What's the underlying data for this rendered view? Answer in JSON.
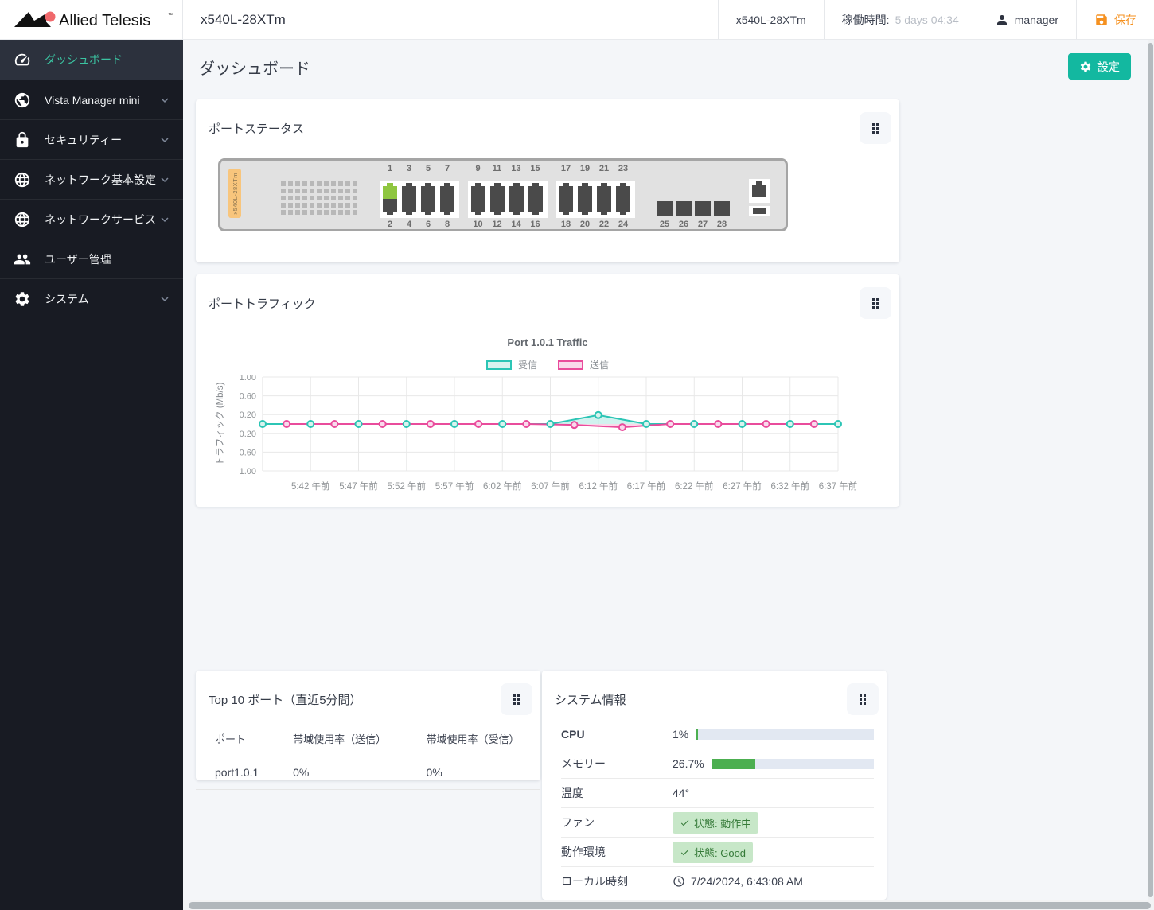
{
  "header": {
    "brand": "Allied Telesis",
    "device_title": "x540L-28XTm",
    "device_name": "x540L-28XTm",
    "uptime_label": "稼働時間:",
    "uptime_value": "5 days 04:34",
    "user": "manager",
    "save_label": "保存",
    "save_color": "#f59120"
  },
  "sidebar": {
    "items": [
      {
        "label": "ダッシュボード",
        "icon": "dashboard-icon",
        "active": true,
        "chevron": false
      },
      {
        "label": "Vista Manager mini",
        "icon": "vista-manager-icon",
        "active": false,
        "chevron": true
      },
      {
        "label": "セキュリティー",
        "icon": "lock-icon",
        "active": false,
        "chevron": true
      },
      {
        "label": "ネットワーク基本設定",
        "icon": "globe-icon",
        "active": false,
        "chevron": true
      },
      {
        "label": "ネットワークサービス",
        "icon": "globe-icon",
        "active": false,
        "chevron": true
      },
      {
        "label": "ユーザー管理",
        "icon": "users-icon",
        "active": false,
        "chevron": false
      },
      {
        "label": "システム",
        "icon": "gear-icon",
        "active": false,
        "chevron": true
      }
    ],
    "active_text_color": "#3bc3a1"
  },
  "page": {
    "title": "ダッシュボード",
    "settings_button": "設定",
    "accent_color": "#13b8a0"
  },
  "port_status": {
    "title": "ポートステータス",
    "device_label": "x540L-28XTm",
    "groups": [
      {
        "top": [
          "1",
          "3",
          "5",
          "7"
        ],
        "bottom": [
          "2",
          "4",
          "6",
          "8"
        ]
      },
      {
        "top": [
          "9",
          "11",
          "13",
          "15"
        ],
        "bottom": [
          "10",
          "12",
          "14",
          "16"
        ]
      },
      {
        "top": [
          "17",
          "19",
          "21",
          "23"
        ],
        "bottom": [
          "18",
          "20",
          "22",
          "24"
        ]
      }
    ],
    "sfp_ports": [
      "25",
      "26",
      "27",
      "28"
    ],
    "up_ports": [
      "1"
    ],
    "port_up_color": "#8fc640",
    "port_down_color": "#4a4a4a"
  },
  "port_traffic": {
    "title": "ポートトラフィック"
  },
  "chart_data": {
    "type": "line",
    "title": "Port 1.0.1 Traffic",
    "ylabel": "トラフィック (Mb/s)",
    "ylim": [
      -1,
      1
    ],
    "grid": true,
    "legend_position": "top",
    "x_ticks": [
      "5:42 午前",
      "5:47 午前",
      "5:52 午前",
      "5:57 午前",
      "6:02 午前",
      "6:07 午前",
      "6:12 午前",
      "6:17 午前",
      "6:22 午前",
      "6:27 午前",
      "6:32 午前",
      "6:37 午前"
    ],
    "y_ticks": [
      {
        "v": 1,
        "label": "1.00"
      },
      {
        "v": 0.6,
        "label": "0.60"
      },
      {
        "v": 0.2,
        "label": "0.20"
      },
      {
        "v": -0.2,
        "label": "0.20"
      },
      {
        "v": -0.6,
        "label": "0.60"
      },
      {
        "v": -1,
        "label": "1.00"
      }
    ],
    "series": [
      {
        "name": "受信",
        "color": "#2cc5b5",
        "fill": "#d9f3ef",
        "marker_fill": "#d9f3ef",
        "point_times": [
          "5:37",
          "5:42",
          "5:47",
          "5:52",
          "5:57",
          "6:02",
          "6:07",
          "6:12",
          "6:17",
          "6:22",
          "6:27",
          "6:32",
          "6:37"
        ],
        "values": [
          0,
          0,
          0,
          0,
          0,
          0,
          0,
          0.19,
          0,
          0,
          0,
          0,
          0
        ]
      },
      {
        "name": "送信",
        "color": "#e94c9c",
        "fill": "#f9d9ec",
        "marker_fill": "#f9d9ec",
        "point_times": [
          "5:39.5",
          "5:44.5",
          "5:49.5",
          "5:54.5",
          "5:59.5",
          "6:04.5",
          "6:09.5",
          "6:14.5",
          "6:19.5",
          "6:24.5",
          "6:29.5",
          "6:34.5"
        ],
        "values": [
          0,
          0,
          0,
          0,
          0,
          0,
          -0.02,
          -0.07,
          0,
          0,
          0,
          0
        ]
      }
    ]
  },
  "top_ports": {
    "title": "Top 10 ポート（直近5分間）",
    "columns": [
      "ポート",
      "帯域使用率（送信）",
      "帯域使用率（受信）"
    ],
    "rows": [
      [
        "port1.0.1",
        "0%",
        "0%"
      ]
    ]
  },
  "system_info": {
    "title": "システム情報",
    "bar_color": "#4caf50",
    "badge_bg": "#c7e7c8",
    "badge_text_color": "#357a38",
    "rows": [
      {
        "label": "CPU",
        "type": "bar",
        "value": "1%",
        "percent": 1,
        "bold": true
      },
      {
        "label": "メモリー",
        "type": "bar",
        "value": "26.7%",
        "percent": 26.7,
        "bold": false
      },
      {
        "label": "温度",
        "type": "text",
        "value": "44°",
        "bold": false
      },
      {
        "label": "ファン",
        "type": "badge",
        "value": "状態: 動作中",
        "bold": false
      },
      {
        "label": "動作環境",
        "type": "badge",
        "value": "状態: Good",
        "bold": false
      },
      {
        "label": "ローカル時刻",
        "type": "clock",
        "value": "7/24/2024, 6:43:08 AM",
        "bold": false
      }
    ]
  },
  "icons": {
    "user": "person-icon",
    "save": "floppy-disk-icon",
    "settings": "gear-icon",
    "widget_handle": "drag-handle-icon",
    "clock": "clock-icon",
    "check": "check-icon"
  }
}
